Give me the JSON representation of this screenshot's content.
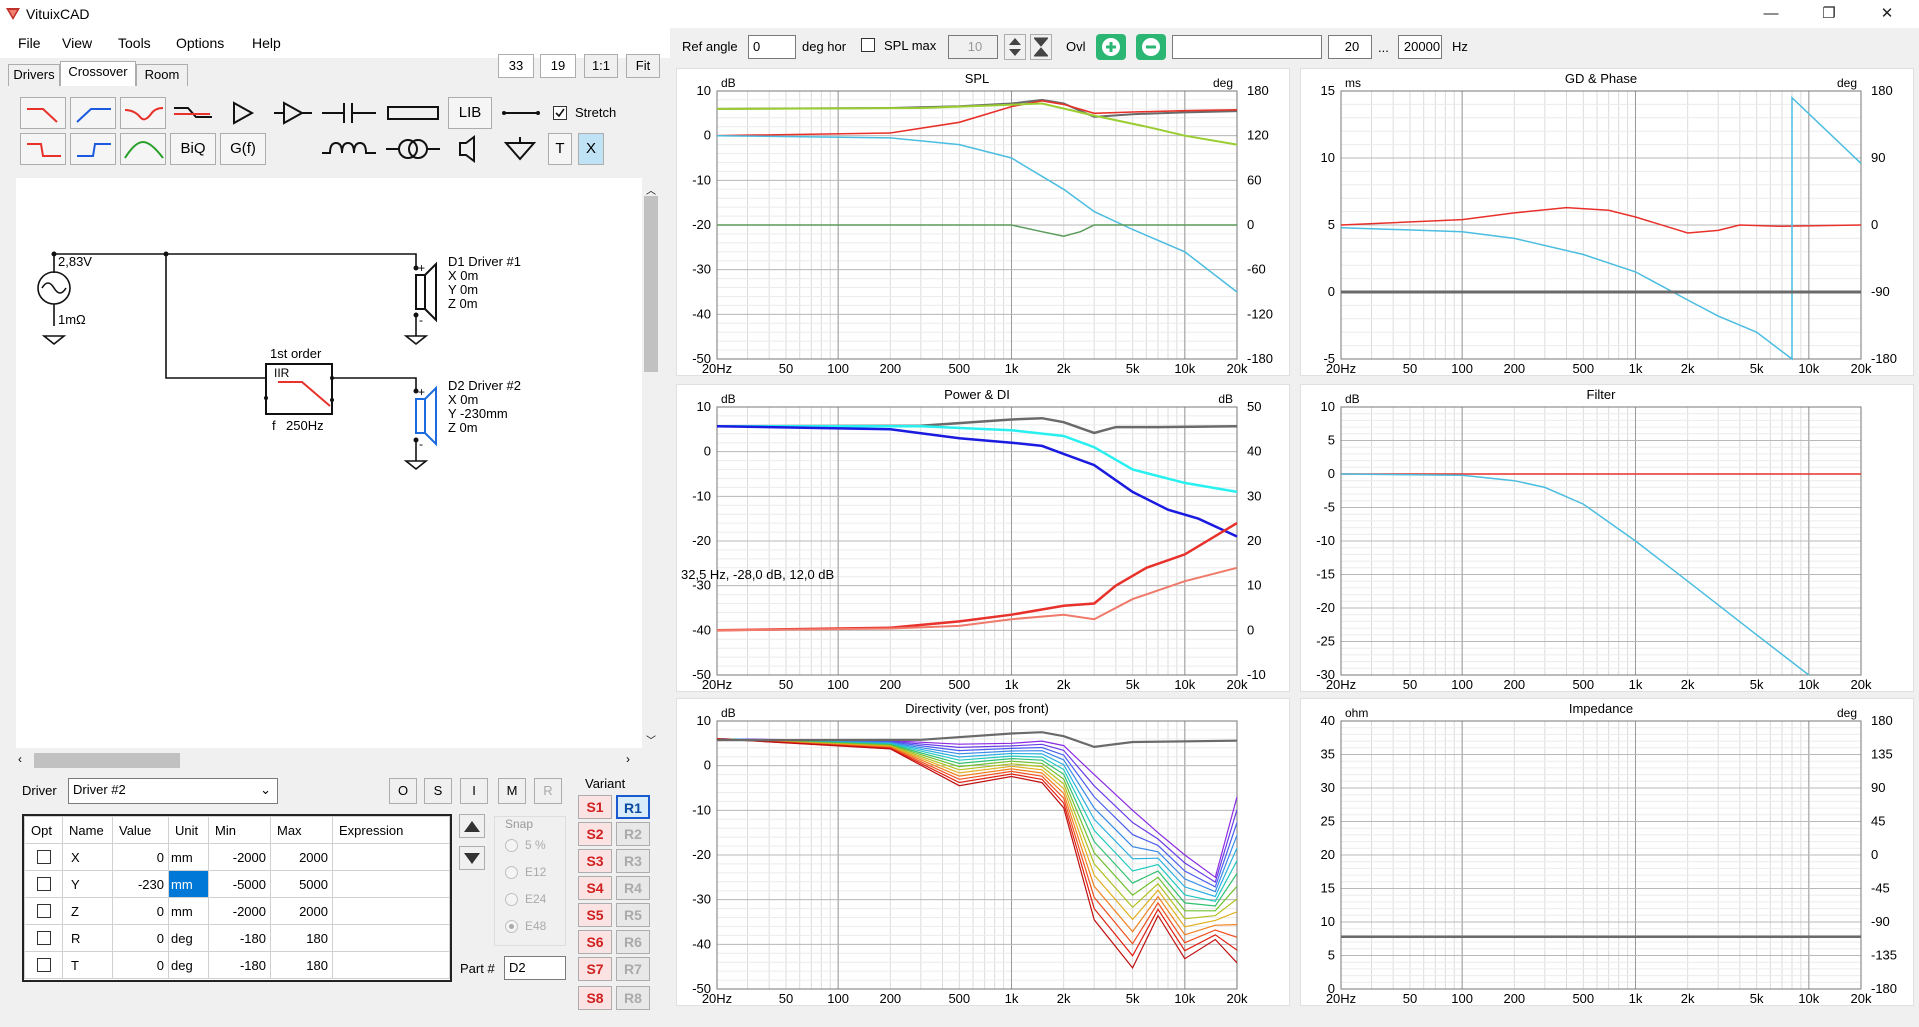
{
  "app": {
    "title": "VituixCAD",
    "window_buttons": [
      "minimize-icon",
      "restore-icon",
      "close-icon"
    ]
  },
  "menu": [
    "File",
    "View",
    "Tools",
    "Options",
    "Help"
  ],
  "tabs": [
    "Drivers",
    "Crossover",
    "Room"
  ],
  "zoom": {
    "a": "33",
    "b": "19",
    "one_to_one": "1:1",
    "fit": "Fit"
  },
  "toolbar": {
    "lib": "LIB",
    "biq": "BiQ",
    "gf": "G(f)",
    "t": "T",
    "x": "X",
    "stretch": "Stretch"
  },
  "schematic": {
    "source_voltage": "2,83V",
    "source_resistance": "1mΩ",
    "d1": {
      "name": "D1 Driver #1",
      "x": "X 0m",
      "y": "Y 0m",
      "z": "Z 0m"
    },
    "d2": {
      "name": "D2 Driver #2",
      "x": "X 0m",
      "y": "Y -230mm",
      "z": "Z 0m"
    },
    "filter": {
      "title": "1st order",
      "type": "IIR",
      "f_label": "f",
      "freq": "250Hz"
    }
  },
  "driver_panel": {
    "label": "Driver",
    "selected": "Driver #2",
    "buttons": [
      "O",
      "S",
      "I",
      "M",
      "R"
    ],
    "columns": [
      "Opt",
      "Name",
      "Value",
      "Unit",
      "Min",
      "Max",
      "Expression"
    ],
    "rows": [
      {
        "name": "X",
        "value": "0",
        "unit": "mm",
        "min": "-2000",
        "max": "2000",
        "expr": ""
      },
      {
        "name": "Y",
        "value": "-230",
        "unit": "mm",
        "min": "-5000",
        "max": "5000",
        "expr": ""
      },
      {
        "name": "Z",
        "value": "0",
        "unit": "mm",
        "min": "-2000",
        "max": "2000",
        "expr": ""
      },
      {
        "name": "R",
        "value": "0",
        "unit": "deg",
        "min": "-180",
        "max": "180",
        "expr": ""
      },
      {
        "name": "T",
        "value": "0",
        "unit": "deg",
        "min": "-180",
        "max": "180",
        "expr": ""
      }
    ],
    "snap": {
      "label": "Snap",
      "options": [
        "5 %",
        "E12",
        "E24",
        "E48"
      ]
    },
    "part_label": "Part #",
    "part_value": "D2",
    "variant": {
      "label": "Variant",
      "s": [
        "S1",
        "S2",
        "S3",
        "S4",
        "S5",
        "S6",
        "S7",
        "S8"
      ],
      "r": [
        "R1",
        "R2",
        "R3",
        "R4",
        "R5",
        "R6",
        "R7",
        "R8"
      ]
    }
  },
  "top_controls": {
    "ref_angle_label": "Ref angle",
    "ref_angle": "0",
    "deg_hor": "deg hor",
    "spl_max": "SPL max",
    "spl_max_value": "10",
    "ovl": "Ovl",
    "ovl_text": "",
    "f_min": "20",
    "dots": "...",
    "f_max": "20000",
    "hz": "Hz"
  },
  "colors": {
    "red": "#e8312b",
    "cyan": "#4bbde0",
    "green": "#9acd32",
    "gray": "#6a6a6a",
    "blue": "#1a1ae0",
    "aqua": "#29f0f0",
    "salmon": "#f07a6a",
    "darkgreen": "#5a9a5a"
  },
  "charts": {
    "x_ticks": [
      "20Hz",
      "50",
      "100",
      "200",
      "500",
      "1k",
      "2k",
      "5k",
      "10k",
      "20k"
    ],
    "spl": {
      "title": "SPL",
      "left_unit": "dB",
      "right_unit": "deg",
      "left_ticks": [
        "10",
        "0",
        "-10",
        "-20",
        "-30",
        "-40",
        "-50"
      ],
      "right_ticks": [
        "180",
        "120",
        "60",
        "0",
        "-60",
        "-120",
        "-180"
      ]
    },
    "gd": {
      "title": "GD & Phase",
      "left_unit": "ms",
      "right_unit": "deg",
      "left_ticks": [
        "15",
        "10",
        "5",
        "0",
        "-5"
      ],
      "right_ticks": [
        "180",
        "90",
        "0",
        "-90",
        "-180"
      ]
    },
    "power": {
      "title": "Power & DI",
      "left_unit": "dB",
      "right_unit": "dB",
      "left_ticks": [
        "10",
        "0",
        "-10",
        "-20",
        "-30",
        "-40",
        "-50"
      ],
      "right_ticks": [
        "50",
        "40",
        "30",
        "20",
        "10",
        "0",
        "-10"
      ],
      "readout": "32,5 Hz, -28,0 dB, 12,0 dB"
    },
    "filter": {
      "title": "Filter",
      "left_unit": "dB",
      "left_ticks": [
        "10",
        "5",
        "0",
        "-5",
        "-10",
        "-15",
        "-20",
        "-25",
        "-30"
      ]
    },
    "directivity": {
      "title": "Directivity (ver, pos front)",
      "left_unit": "dB",
      "left_ticks": [
        "10",
        "0",
        "-10",
        "-20",
        "-30",
        "-40",
        "-50"
      ]
    },
    "impedance": {
      "title": "Impedance",
      "left_unit": "ohm",
      "right_unit": "deg",
      "left_ticks": [
        "40",
        "35",
        "30",
        "25",
        "20",
        "15",
        "10",
        "5",
        "0"
      ],
      "right_ticks": [
        "180",
        "135",
        "90",
        "45",
        "0",
        "-45",
        "-90",
        "-135",
        "-180"
      ]
    }
  }
}
